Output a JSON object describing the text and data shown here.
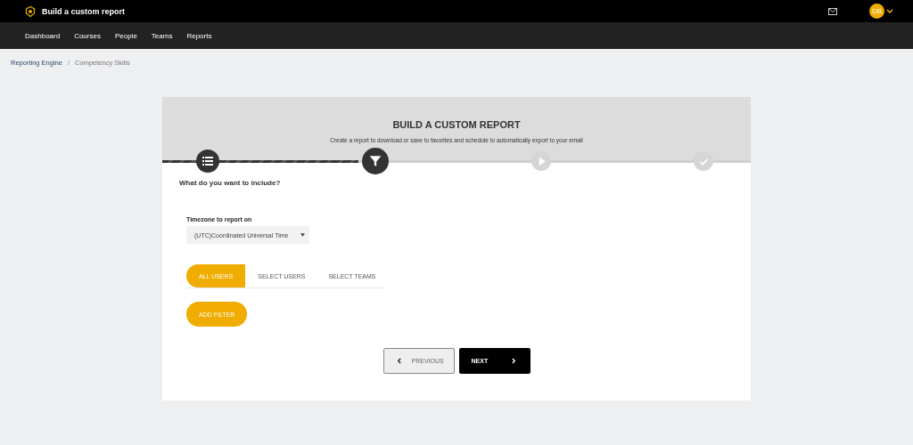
{
  "topbar": {
    "title": "Build a custom report",
    "avatar": "DB"
  },
  "nav": [
    {
      "label": "Dashboard"
    },
    {
      "label": "Courses"
    },
    {
      "label": "People"
    },
    {
      "label": "Teams"
    },
    {
      "label": "Reports"
    }
  ],
  "breadcrumb_separator": "/",
  "breadcrumb": [
    {
      "label": "Reporting Engine",
      "kind": "link"
    },
    {
      "label": "Competency Skills",
      "kind": "current"
    }
  ],
  "card": {
    "title": "BUILD A CUSTOM REPORT",
    "subtitle": "Create a report to download or save to favorites and schedule to automatically export to your email",
    "steps": [
      {
        "kind": "list",
        "completed": true,
        "selected": false
      },
      {
        "kind": "filter",
        "completed": false,
        "selected": true
      },
      {
        "kind": "play",
        "completed": false,
        "selected": false
      },
      {
        "kind": "check",
        "completed": false,
        "selected": false
      }
    ],
    "question": "What do you want to include?",
    "timezone": {
      "label": "Timezone to report on",
      "value": "(UTC)Coordinated Universal Time"
    },
    "user_tabs": [
      {
        "label": "ALL USERS",
        "selected": true
      },
      {
        "label": "SELECT USERS",
        "selected": false
      },
      {
        "label": "SELECT TEAMS",
        "selected": false
      }
    ],
    "add_filter": "ADD FILTER",
    "previous": "PREVIOUS",
    "next": "NEXT"
  }
}
